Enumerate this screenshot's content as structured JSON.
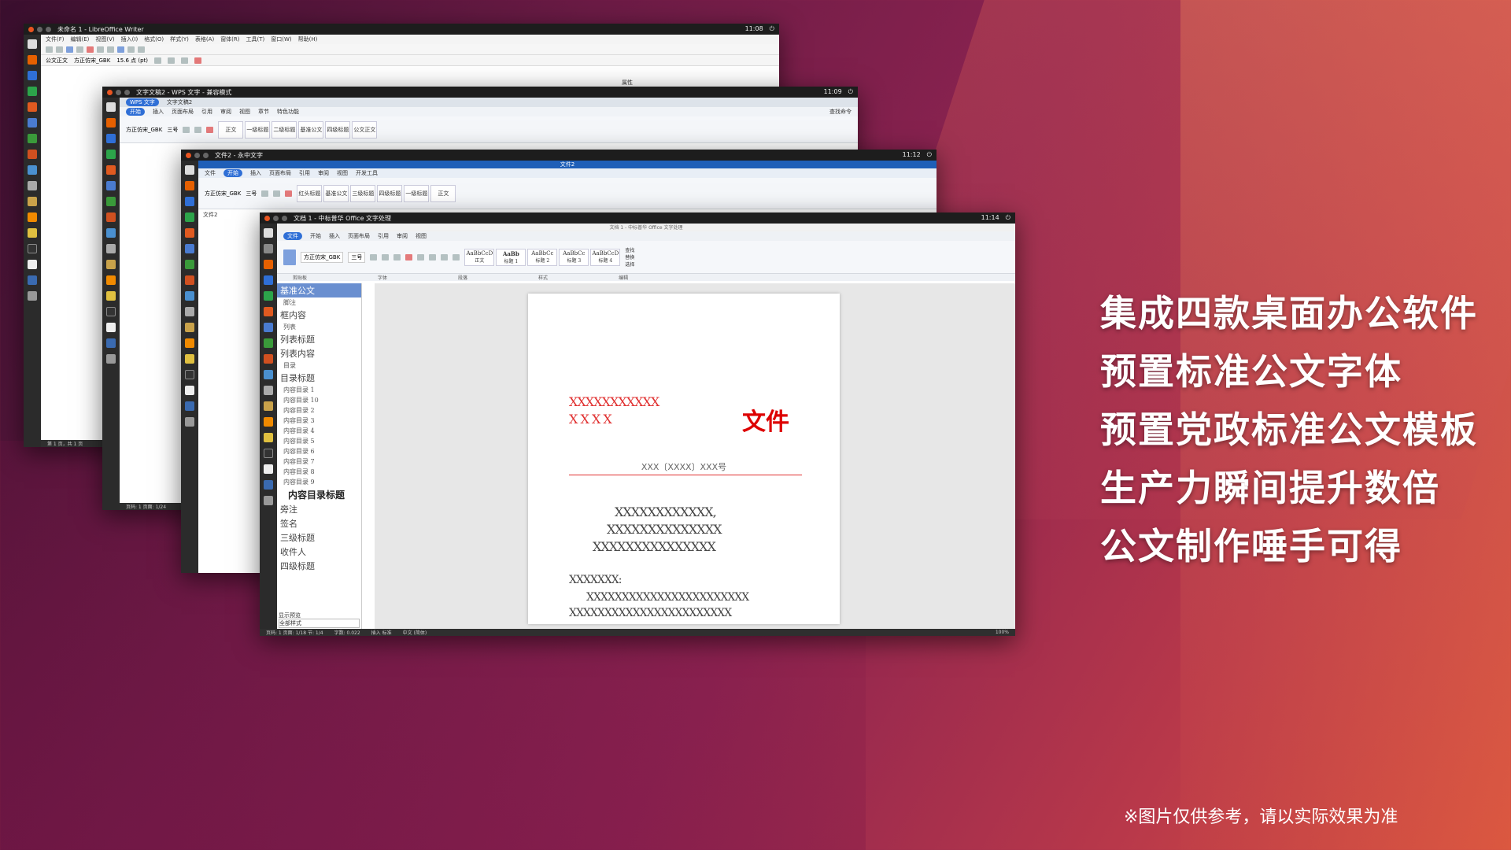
{
  "windows": {
    "libreoffice": {
      "title": "未命名 1 - LibreOffice Writer",
      "time": "11:08",
      "menus": [
        "文件(F)",
        "编辑(E)",
        "视图(V)",
        "插入(I)",
        "格式(O)",
        "样式(Y)",
        "表格(A)",
        "窗体(R)",
        "工具(T)",
        "窗口(W)",
        "帮助(H)"
      ],
      "para_style": "公文正文",
      "font_name": "方正仿宋_GBK",
      "font_size": "15.6 点 (pt)",
      "sidebar_label": "属性",
      "status": "第 1 页，共 1 页"
    },
    "wps": {
      "title": "文字文稿2 - WPS 文字 - 兼容模式",
      "time": "11:09",
      "tabs": [
        "WPS 文字",
        "文字文稿2"
      ],
      "ribbon_tabs": [
        "开始",
        "插入",
        "页面布局",
        "引用",
        "审阅",
        "视图",
        "章节",
        "特色功能"
      ],
      "active_tab": "开始",
      "search": "查找命令",
      "font_name": "方正仿宋_GBK",
      "font_size": "三号",
      "styles": [
        "正文",
        "一级标题",
        "二级标题",
        "基准公文",
        "四级标题",
        "公文正文"
      ],
      "status": "页码: 1  页面: 1/24"
    },
    "yozo": {
      "title": "文件2 - 永中文字",
      "time": "11:12",
      "tabs": [
        "文件",
        "开始",
        "插入",
        "页面布局",
        "引用",
        "审阅",
        "视图",
        "开发工具"
      ],
      "doc_title": "文件2",
      "active_tab": "开始",
      "font_name": "方正仿宋_GBK",
      "font_size": "三号",
      "styles": [
        "红头标题",
        "基准公文",
        "三级标题",
        "四级标题",
        "一级标题",
        "正文"
      ],
      "doc_tab": "文件2"
    },
    "zhongbiao": {
      "title": "文档 1 - 中标普华 Office 文字处理",
      "subtitle": "文档 1 - 中标普华 Office 文字处理",
      "time": "11:14",
      "tabs": [
        "文件",
        "开始",
        "插入",
        "页面布局",
        "引用",
        "审阅",
        "视图"
      ],
      "active_tab": "开始",
      "font_name": "方正仿宋_GBK",
      "font_size": "三号",
      "groups": [
        "剪贴板",
        "字体",
        "段落",
        "样式",
        "编辑"
      ],
      "styles": [
        {
          "preview": "AaBbCcD",
          "name": "正文"
        },
        {
          "preview": "AaBb",
          "name": "标题 1"
        },
        {
          "preview": "AaBbCc",
          "name": "标题 2"
        },
        {
          "preview": "AaBbCc",
          "name": "标题 3"
        },
        {
          "preview": "AaBbCcD",
          "name": "标题 4"
        }
      ],
      "edit_buttons": [
        "查找",
        "替换",
        "选择"
      ],
      "style_list": [
        {
          "text": "基准公文",
          "kind": "sel"
        },
        {
          "text": "脚注",
          "kind": "small"
        },
        {
          "text": "框内容",
          "kind": "normal"
        },
        {
          "text": "列表",
          "kind": "small"
        },
        {
          "text": "列表标题",
          "kind": "normal"
        },
        {
          "text": "列表内容",
          "kind": "normal"
        },
        {
          "text": "目录",
          "kind": "small"
        },
        {
          "text": "目录标题",
          "kind": "normal"
        },
        {
          "text": "内容目录 1",
          "kind": "small"
        },
        {
          "text": "内容目录 10",
          "kind": "small"
        },
        {
          "text": "内容目录 2",
          "kind": "small"
        },
        {
          "text": "内容目录 3",
          "kind": "small"
        },
        {
          "text": "内容目录 4",
          "kind": "small"
        },
        {
          "text": "内容目录 5",
          "kind": "small"
        },
        {
          "text": "内容目录 6",
          "kind": "small"
        },
        {
          "text": "内容目录 7",
          "kind": "small"
        },
        {
          "text": "内容目录 8",
          "kind": "small"
        },
        {
          "text": "内容目录 9",
          "kind": "small"
        },
        {
          "text": "内容目录标题",
          "kind": "bold"
        },
        {
          "text": "旁注",
          "kind": "normal"
        },
        {
          "text": "签名",
          "kind": "normal"
        },
        {
          "text": "三级标题",
          "kind": "normal"
        },
        {
          "text": "收件人",
          "kind": "normal"
        },
        {
          "text": "四级标题",
          "kind": "normal"
        }
      ],
      "show_preview": "显示预览",
      "style_filter": "全部样式",
      "doc": {
        "red_header_row1": "XXXXXXXXXXX",
        "red_header_row2": "X     X     X     X",
        "wenjian": "文件",
        "doc_number": "XXX〔XXXX〕XXX号",
        "title_lines": [
          "XXXXXXXXXXXX,",
          "XXXXXXXXXXXXXX",
          "XXXXXXXXXXXXXXX"
        ],
        "salutation": "XXXXXXX:",
        "body_lines": [
          "XXXXXXXXXXXXXXXXXXXXXXX",
          "XXXXXXXXXXXXXXXXXXXXXXX"
        ]
      },
      "status_left": "页码: 1  页面: 1/18  节: 1/4",
      "status_words": "字数: 0.022",
      "status_mid": "插入  标准",
      "status_lang": "中文 (简体)",
      "zoom": "100%"
    }
  },
  "taglines": [
    "集成四款桌面办公软件",
    "预置标准公文字体",
    "预置党政标准公文模板",
    "生产力瞬间提升数倍",
    "公文制作唾手可得"
  ],
  "disclaimer": "※图片仅供参考，请以实际效果为准",
  "colors": {
    "accent_orange": "#e95420",
    "wps_blue": "#2f6fd6",
    "doc_red": "#e03030"
  }
}
